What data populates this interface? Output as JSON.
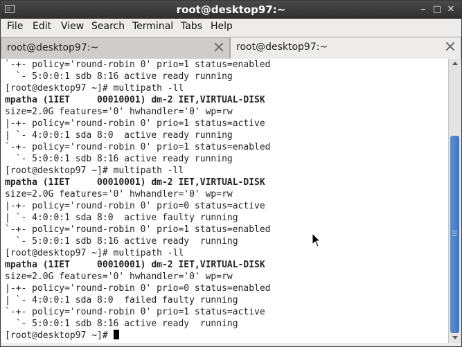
{
  "window": {
    "title": "root@desktop97:~"
  },
  "menu": [
    "File",
    "Edit",
    "View",
    "Search",
    "Terminal",
    "Tabs",
    "Help"
  ],
  "tabs": [
    {
      "label": "root@desktop97:~",
      "active": false
    },
    {
      "label": "root@desktop97:~",
      "active": true
    }
  ],
  "terminal": {
    "lines": [
      "`-+- policy='round-robin 0' prio=1 status=enabled",
      "  `- 5:0:0:1 sdb 8:16 active ready running",
      "[root@desktop97 ~]# multipath -ll",
      "mpatha (1IET     00010001) dm-2 IET,VIRTUAL-DISK",
      "size=2.0G features='0' hwhandler='0' wp=rw",
      "|-+- policy='round-robin 0' prio=1 status=active",
      "| `- 4:0:0:1 sda 8:0  active ready running",
      "`-+- policy='round-robin 0' prio=1 status=enabled",
      "  `- 5:0:0:1 sdb 8:16 active ready running",
      "[root@desktop97 ~]# multipath -ll",
      "mpatha (1IET     00010001) dm-2 IET,VIRTUAL-DISK",
      "size=2.0G features='0' hwhandler='0' wp=rw",
      "|-+- policy='round-robin 0' prio=0 status=active",
      "| `- 4:0:0:1 sda 8:0  active faulty running",
      "`-+- policy='round-robin 0' prio=1 status=enabled",
      "  `- 5:0:0:1 sdb 8:16 active ready  running",
      "[root@desktop97 ~]# multipath -ll",
      "mpatha (1IET     00010001) dm-2 IET,VIRTUAL-DISK",
      "size=2.0G features='0' hwhandler='0' wp=rw",
      "|-+- policy='round-robin 0' prio=0 status=enabled",
      "| `- 4:0:0:1 sda 8:0  failed faulty running",
      "`-+- policy='round-robin 0' prio=1 status=active",
      "  `- 5:0:0:1 sdb 8:16 active ready  running"
    ],
    "prompt": "[root@desktop97 ~]# "
  },
  "colors": {
    "titlebar": "#3a3a3a",
    "terminal_bg": "#ffffff",
    "scroll_thumb": "#4a7cc7"
  }
}
